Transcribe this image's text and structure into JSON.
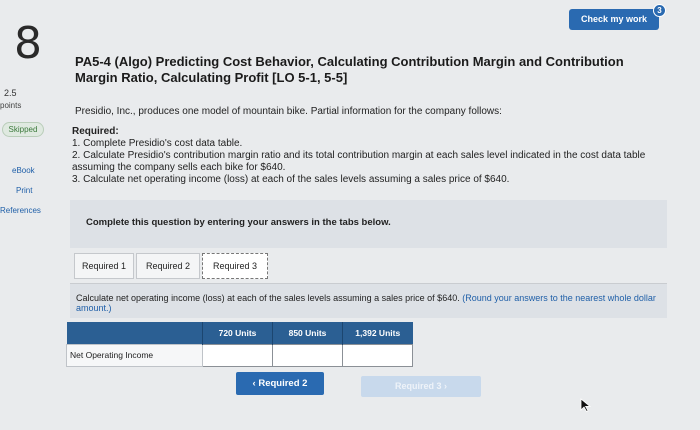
{
  "question": {
    "number": "8"
  },
  "sidebar": {
    "points_value": "2.5",
    "points_label": "points",
    "status": "Skipped",
    "ebook": "eBook",
    "print": "Print",
    "references": "References"
  },
  "header": {
    "check_button": "Check my work",
    "badge_count": "3"
  },
  "problem": {
    "title": "PA5-4 (Algo) Predicting Cost Behavior, Calculating Contribution Margin and Contribution Margin Ratio, Calculating Profit [LO 5-1, 5-5]",
    "intro": "Presidio, Inc., produces one model of mountain bike. Partial information for the company follows:",
    "required_heading": "Required:",
    "required_items": [
      "1. Complete Presidio's cost data table.",
      "2. Calculate Presidio's contribution margin ratio and its total contribution margin at each sales level indicated in the cost data table assuming the company sells each bike for $640.",
      "3. Calculate net operating income (loss) at each of the sales levels assuming a sales price of $640."
    ]
  },
  "complete_prompt": "Complete this question by entering your answers in the tabs below.",
  "tabs": [
    "Required 1",
    "Required 2",
    "Required 3"
  ],
  "active_tab": "Required 3",
  "instruction": {
    "text": "Calculate net operating income (loss) at each of the sales levels assuming a sales price of $640.",
    "hint": "(Round your answers to the nearest whole dollar amount.)"
  },
  "table": {
    "columns": [
      "720 Units",
      "850 Units",
      "1,392 Units"
    ],
    "row_label": "Net Operating Income",
    "values": [
      "",
      "",
      ""
    ]
  },
  "nav": {
    "prev": "Required 2",
    "next": "Required 3"
  },
  "colors": {
    "accent": "#2a6ab1",
    "header": "#2b5f93",
    "panel": "#dde1e6"
  }
}
